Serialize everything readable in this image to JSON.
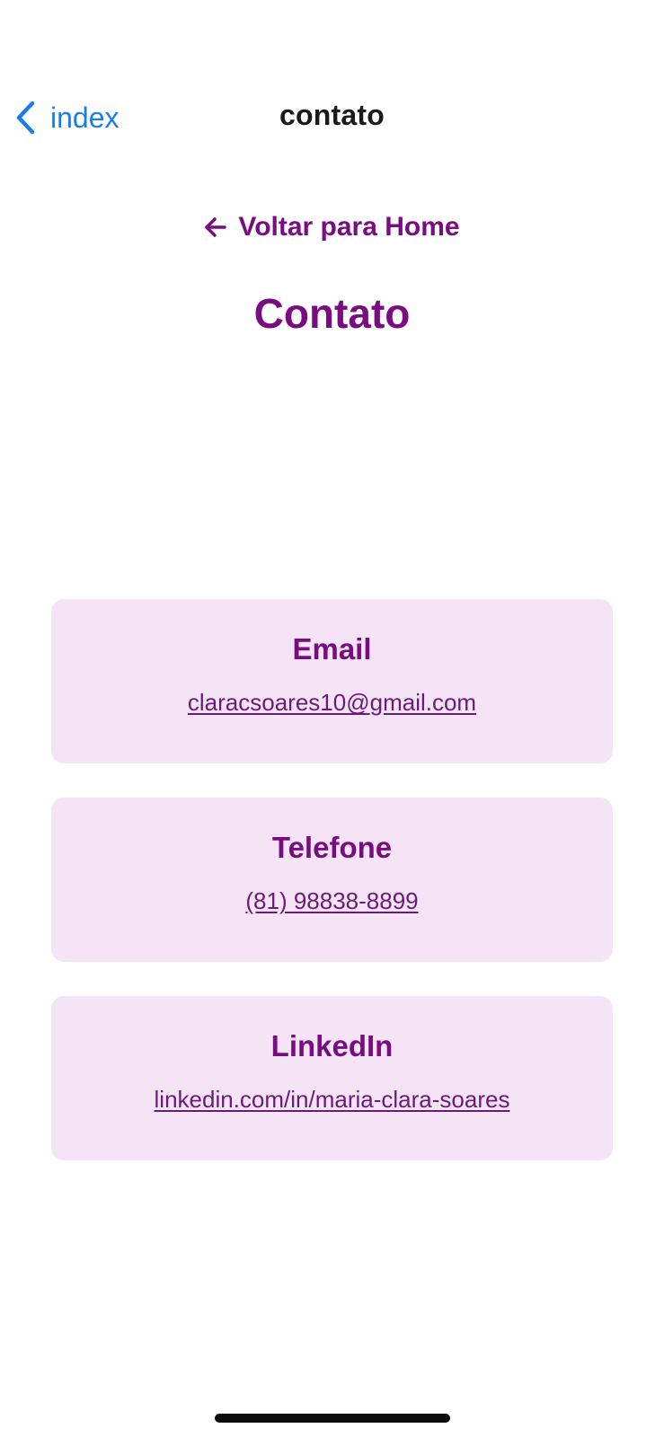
{
  "navbar": {
    "back_label": "index",
    "title": "contato",
    "back_icon": "chevron-left-icon",
    "accent_color": "#1a7ee8"
  },
  "content": {
    "back_home_label": "Voltar para Home",
    "back_home_icon": "arrow-left-icon",
    "title": "Contato",
    "brand_color": "#7a0c82",
    "card_background": "#f4e4f6"
  },
  "cards": [
    {
      "title": "Email",
      "value": "claracsoares10@gmail.com"
    },
    {
      "title": "Telefone",
      "value": "(81) 98838-8899"
    },
    {
      "title": "LinkedIn",
      "value": "linkedin.com/in/maria-clara-soares"
    }
  ]
}
